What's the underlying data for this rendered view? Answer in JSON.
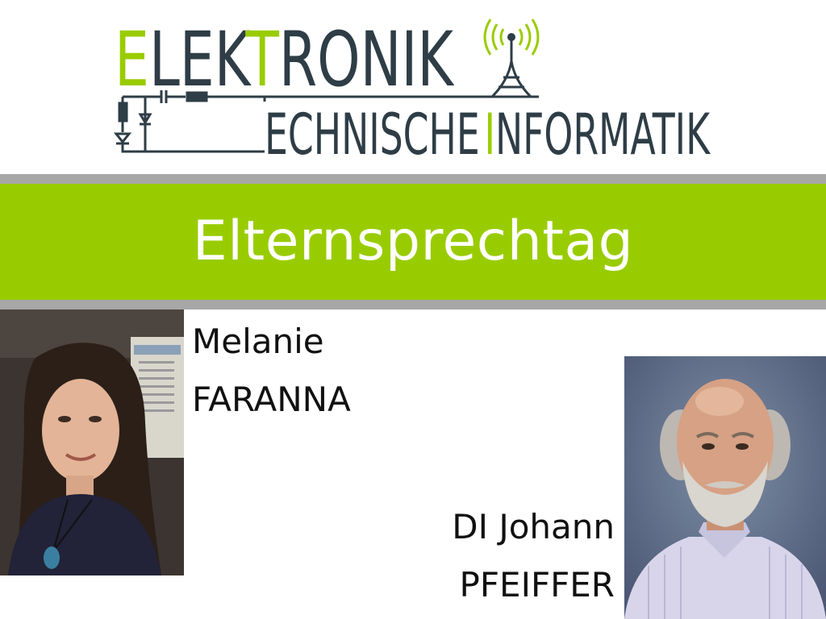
{
  "logo": {
    "line1_accent": "E",
    "line1_a": "LEK",
    "line1_accent2": "T",
    "line1_b": "RONIK",
    "line2_a": "ECHNISCHE",
    "line2_accent": "I",
    "line2_b": "NFORMATIK",
    "colors": {
      "accent": "#99cc00",
      "text": "#2e3d46"
    }
  },
  "banner": {
    "title": "Elternsprechtag"
  },
  "persons": [
    {
      "first_line": "Melanie",
      "second_line": "FARANNA"
    },
    {
      "first_line": "DI Johann",
      "second_line": "PFEIFFER"
    }
  ],
  "colors": {
    "banner": "#99cc00",
    "divider": "#a7a7a7",
    "banner_text": "#ffffff",
    "name_text": "#111111"
  }
}
